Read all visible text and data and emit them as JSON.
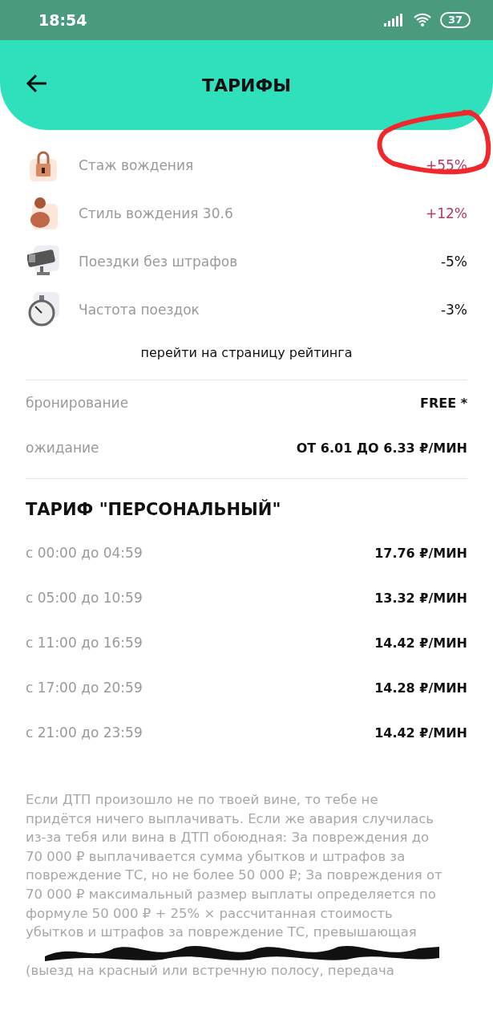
{
  "status_bar": {
    "time": "18:54",
    "battery": "37"
  },
  "header": {
    "title": "ТАРИФЫ"
  },
  "rating_factors": [
    {
      "label": "Стаж вождения",
      "value": "+55%",
      "color": "#b23a5c",
      "annotated": true
    },
    {
      "label": "Стиль вождения 30.6",
      "value": "+12%",
      "color": "#b23a5c",
      "annotated": false
    },
    {
      "label": "Поездки без штрафов",
      "value": "-5%",
      "color": "#111111",
      "annotated": false
    },
    {
      "label": "Частота поездок",
      "value": "-3%",
      "color": "#111111",
      "annotated": false
    }
  ],
  "rating_link": "перейти на страницу рейтинга",
  "fees": [
    {
      "label": "бронирование",
      "value": "FREE *"
    },
    {
      "label": "ожидание",
      "value": "ОТ 6.01 ДО 6.33 ₽/МИН"
    }
  ],
  "tariff": {
    "title": "ТАРИФ \"ПЕРСОНАЛЬНЫЙ\"",
    "rows": [
      {
        "period": "с 00:00 до 04:59",
        "price": "17.76 ₽/МИН"
      },
      {
        "period": "с 05:00 до 10:59",
        "price": "13.32 ₽/МИН"
      },
      {
        "period": "с 11:00 до 16:59",
        "price": "14.42 ₽/МИН"
      },
      {
        "period": "с 17:00 до 20:59",
        "price": "14.28 ₽/МИН"
      },
      {
        "period": "с 21:00 до 23:59",
        "price": "14.42 ₽/МИН"
      }
    ]
  },
  "notice": {
    "text": "Если ДТП произошло не по твоей вине, то тебе не придётся ничего выплачивать. Если же авария случилась из-за тебя или вина в ДТП обоюдная: За повреждения до 70 000 ₽ выплачивается сумма убытков и штрафов за повреждение ТС, но не более 50 000 ₽; За повреждения от 70 000 ₽ максимальный размер выплаты определяется по формуле 50 000 ₽ + 25% × рассчитанная стоимость убытков и штрафов за повреждение ТС, превышающая",
    "continued": "(выезд на красный или встречную полосу, передача"
  }
}
